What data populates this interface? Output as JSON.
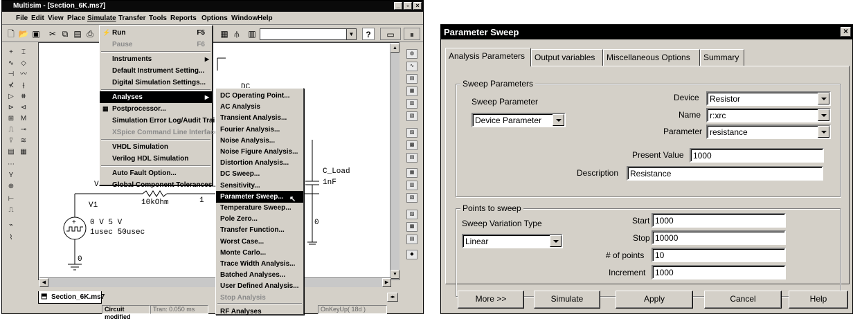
{
  "multisim": {
    "title": "Multisim - [Section_6K.ms7]",
    "menus": [
      "File",
      "Edit",
      "View",
      "Place",
      "Simulate",
      "Transfer",
      "Tools",
      "Reports",
      "Options",
      "Window",
      "Help"
    ],
    "simulate_menu": [
      {
        "label": "Run",
        "key": "F5",
        "disabled": false
      },
      {
        "label": "Pause",
        "key": "F6",
        "disabled": true
      },
      {
        "label": "Instruments",
        "submenu": true
      },
      {
        "label": "Default Instrument Setting..."
      },
      {
        "label": "Digital Simulation Settings..."
      },
      {
        "label": "Analyses",
        "submenu": true,
        "selected": true
      },
      {
        "label": "Postprocessor..."
      },
      {
        "label": "Simulation Error Log/Audit Trail"
      },
      {
        "label": "XSpice Command Line Interface",
        "disabled": true
      },
      {
        "label": "VHDL Simulation"
      },
      {
        "label": "Verilog HDL Simulation"
      },
      {
        "label": "Auto Fault Option..."
      },
      {
        "label": "Global Component Tolerances..."
      }
    ],
    "analyses_menu": [
      "DC Operating Point...",
      "AC Analysis",
      "Transient Analysis...",
      "Fourier Analysis...",
      "Noise Analysis...",
      "Noise Figure Analysis...",
      "Distortion Analysis...",
      "DC Sweep...",
      "Sensitivity...",
      "Parameter Sweep...",
      "Temperature Sweep...",
      "Pole Zero...",
      "Transfer Function...",
      "Worst Case...",
      "Monte Carlo...",
      "Trace Width Analysis...",
      "Batched Analyses...",
      "User Defined Analysis...",
      "Stop Analysis",
      "RF Analyses"
    ],
    "analyses_selected_index": 9,
    "analyses_disabled": [
      "Stop Analysis"
    ],
    "schematic": {
      "vin": "Vin",
      "v1": "V1",
      "resistor": "10kOhm",
      "node1": "1",
      "source_line1": "0 V 5 V",
      "source_line2": "1usec 50usec",
      "ground": "0",
      "cap_name": "C_Load",
      "cap_value": "1nF",
      "node0": "0",
      "dc": "DC"
    },
    "doc_tab": "Section_6K.ms7",
    "status": [
      "Circuit modified",
      "Tran: 0.050 ms",
      "OnKeyUp( 18d )"
    ]
  },
  "dialog": {
    "title": "Parameter Sweep",
    "tabs": [
      "Analysis Parameters",
      "Output variables",
      "Miscellaneous Options",
      "Summary"
    ],
    "sweep_params_group": "Sweep Parameters",
    "sweep_parameter_label": "Sweep Parameter",
    "sweep_parameter_value": "Device Parameter",
    "device_label": "Device",
    "device_value": "Resistor",
    "name_label": "Name",
    "name_value": "r:xrc",
    "parameter_label": "Parameter",
    "parameter_value": "resistance",
    "present_value_label": "Present Value",
    "present_value": "1000",
    "description_label": "Description",
    "description_value": "Resistance",
    "points_group": "Points to sweep",
    "variation_type_label": "Sweep Variation Type",
    "variation_type_value": "Linear",
    "start_label": "Start",
    "start_value": "1000",
    "stop_label": "Stop",
    "stop_value": "10000",
    "points_label": "# of points",
    "points_value": "10",
    "increment_label": "Increment",
    "increment_value": "1000",
    "buttons": [
      "More >>",
      "Simulate",
      "Apply",
      "Cancel",
      "Help"
    ]
  }
}
